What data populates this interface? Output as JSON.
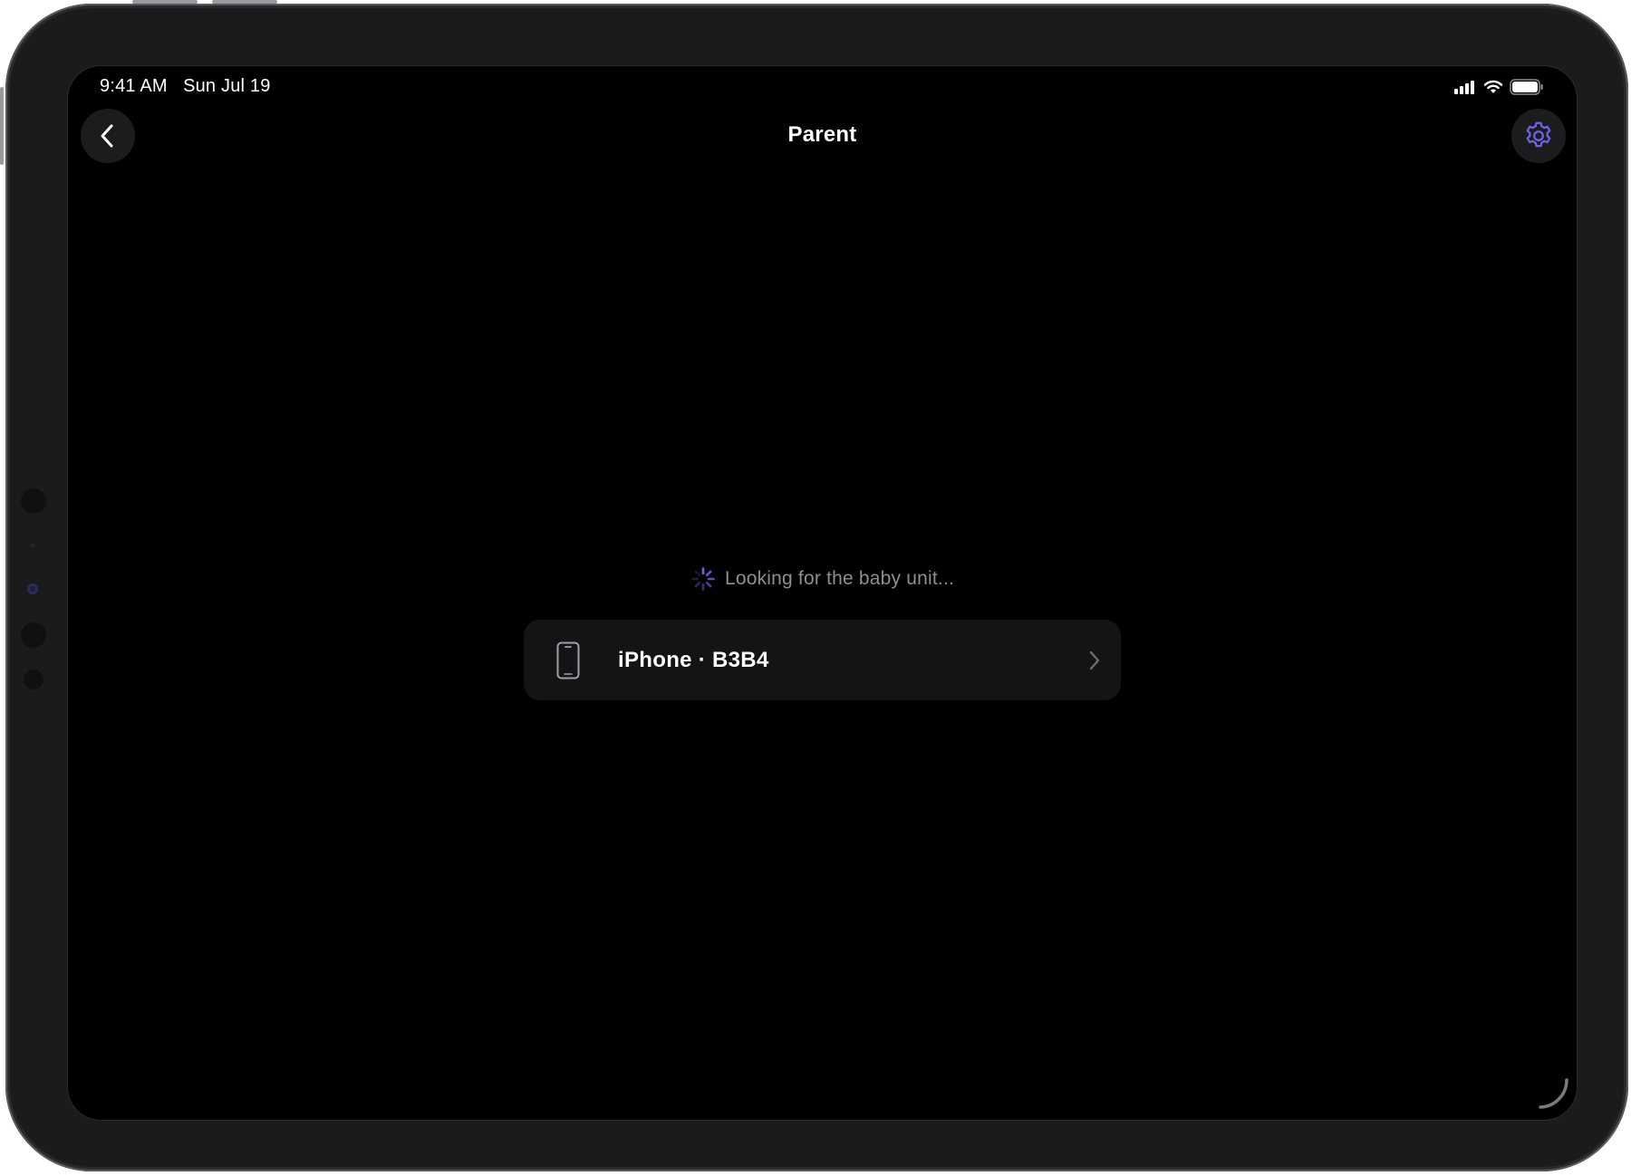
{
  "status_bar": {
    "time": "9:41 AM",
    "date": "Sun Jul 19",
    "icons": [
      "cellular-signal-icon",
      "wifi-icon",
      "battery-icon"
    ]
  },
  "nav": {
    "title": "Parent",
    "back_icon": "chevron-left-icon",
    "settings_icon": "gear-icon"
  },
  "main": {
    "search_status": "Looking for the baby unit...",
    "search_icon": "activity-spinner-icon",
    "devices": [
      {
        "label": "iPhone · B3B4",
        "icon": "iphone-icon",
        "accessory": "chevron-right-icon"
      }
    ]
  },
  "colors": {
    "accent": "#6e63e6",
    "background": "#000000",
    "surface": "#1c1c1e",
    "row_surface": "#141416",
    "secondary_text": "#8e8e93"
  }
}
